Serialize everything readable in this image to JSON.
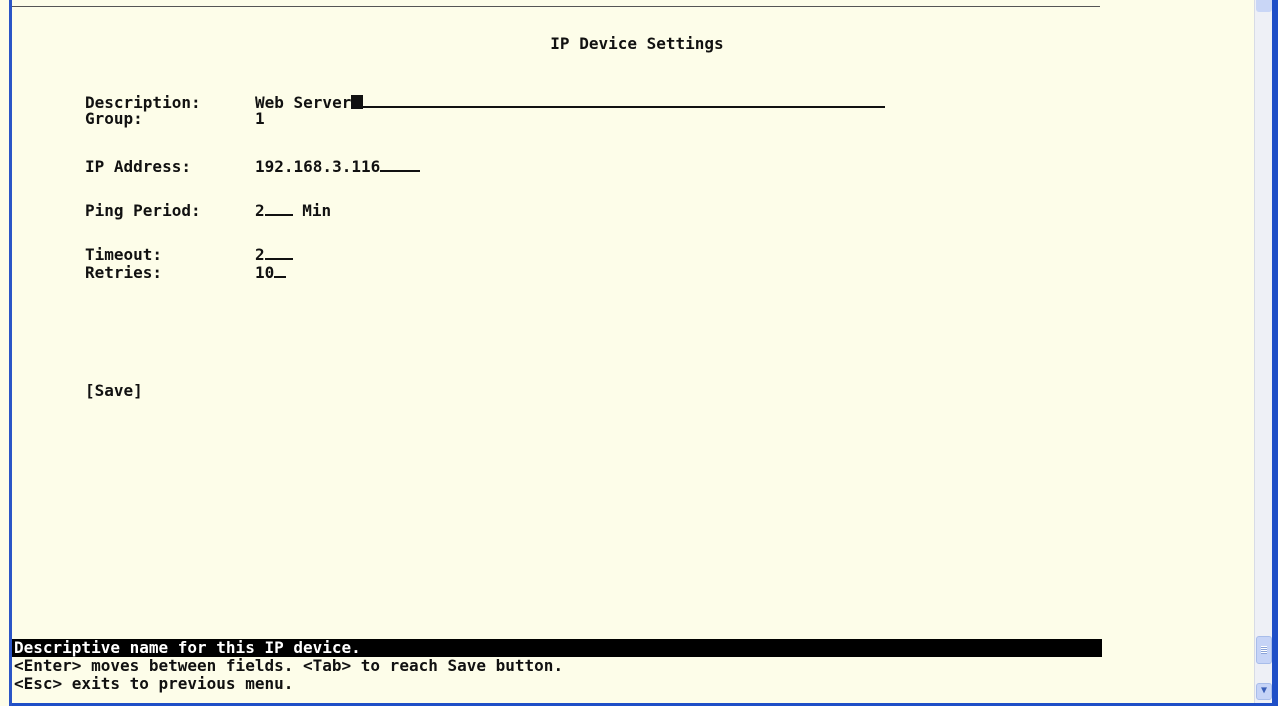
{
  "screen": {
    "title": "IP Device Settings"
  },
  "form": {
    "description_label": "Description:",
    "description_value": "Web Server",
    "group_label": "Group:",
    "group_value": "1",
    "ip_label": "IP Address:",
    "ip_value": "192.168.3.116",
    "ping_label": "Ping Period:",
    "ping_value": "2",
    "ping_unit": "Min",
    "timeout_label": "Timeout:",
    "timeout_value": "2",
    "retries_label": "Retries:",
    "retries_value": "10",
    "save_label": "[Save]"
  },
  "status": {
    "hint": "Descriptive name for this IP device.",
    "help_line1": "<Enter> moves between fields. <Tab> to reach Save button.",
    "help_line2": "<Esc> exits to previous menu."
  },
  "colors": {
    "background": "#fdfde9",
    "status_bar": "#000000",
    "window_frame": "#1f4fc7"
  }
}
